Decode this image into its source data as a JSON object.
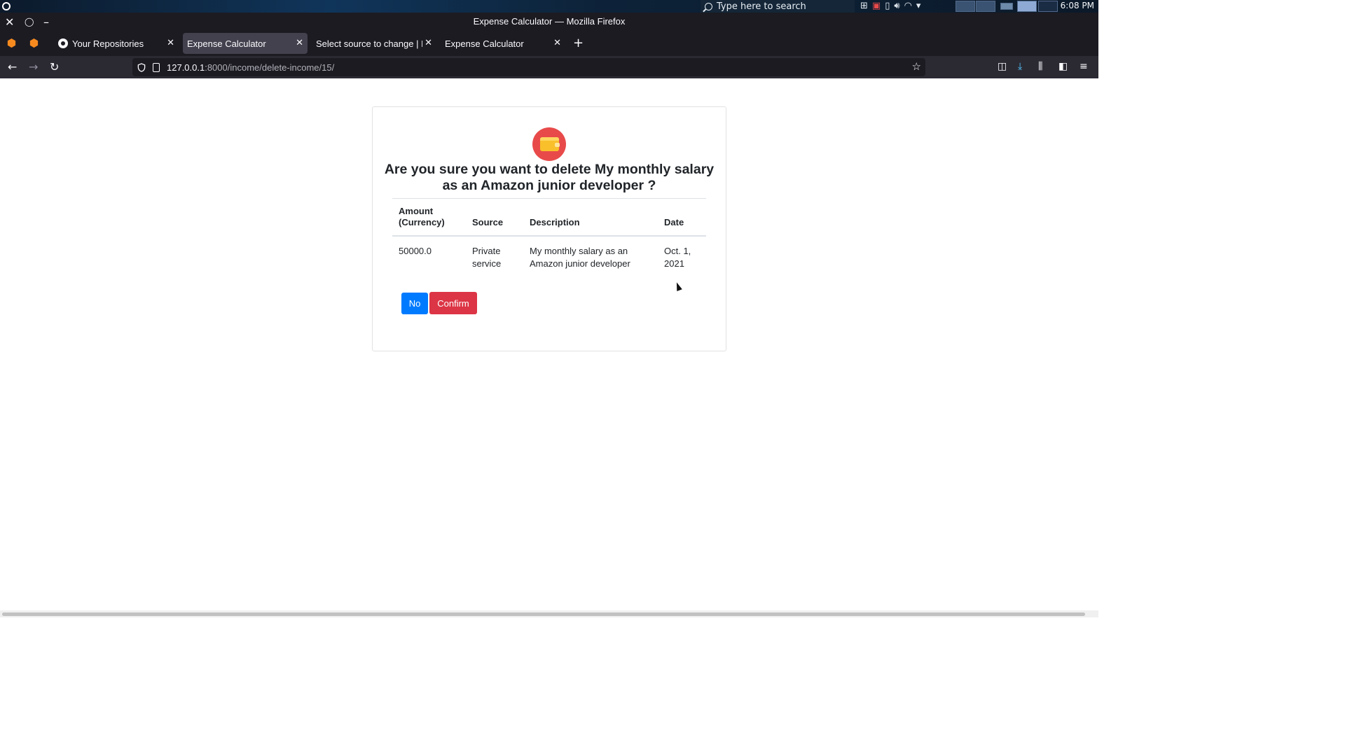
{
  "os": {
    "search_placeholder": "Type here to search",
    "clock": "6:08 PM"
  },
  "window": {
    "title": "Expense Calculator — Mozilla Firefox"
  },
  "tabs": [
    {
      "label": "Your Repositories",
      "icon": "github-icon"
    },
    {
      "label": "Expense Calculator",
      "active": true
    },
    {
      "label": "Select source to change | Djan"
    },
    {
      "label": "Expense Calculator"
    }
  ],
  "urlbar": {
    "host": "127.0.0.1",
    "path": ":8000/income/delete-income/15/"
  },
  "dialog": {
    "icon": "wallet-icon",
    "heading": "Are you sure you want to delete My monthly salary as an Amazon junior developer ?",
    "table": {
      "headers": [
        "Amount (Currency)",
        "Source",
        "Description",
        "Date"
      ],
      "row": {
        "amount": "50000.0",
        "source": "Private service",
        "description": "My monthly salary as an Amazon junior developer",
        "date": "Oct. 1, 2021"
      }
    },
    "buttons": {
      "no": "No",
      "confirm": "Confirm"
    }
  },
  "colors": {
    "no_button": "#007bff",
    "confirm_button": "#dc3545",
    "wallet_circle": "#e84a4a",
    "wallet_body": "#f9c02b"
  }
}
